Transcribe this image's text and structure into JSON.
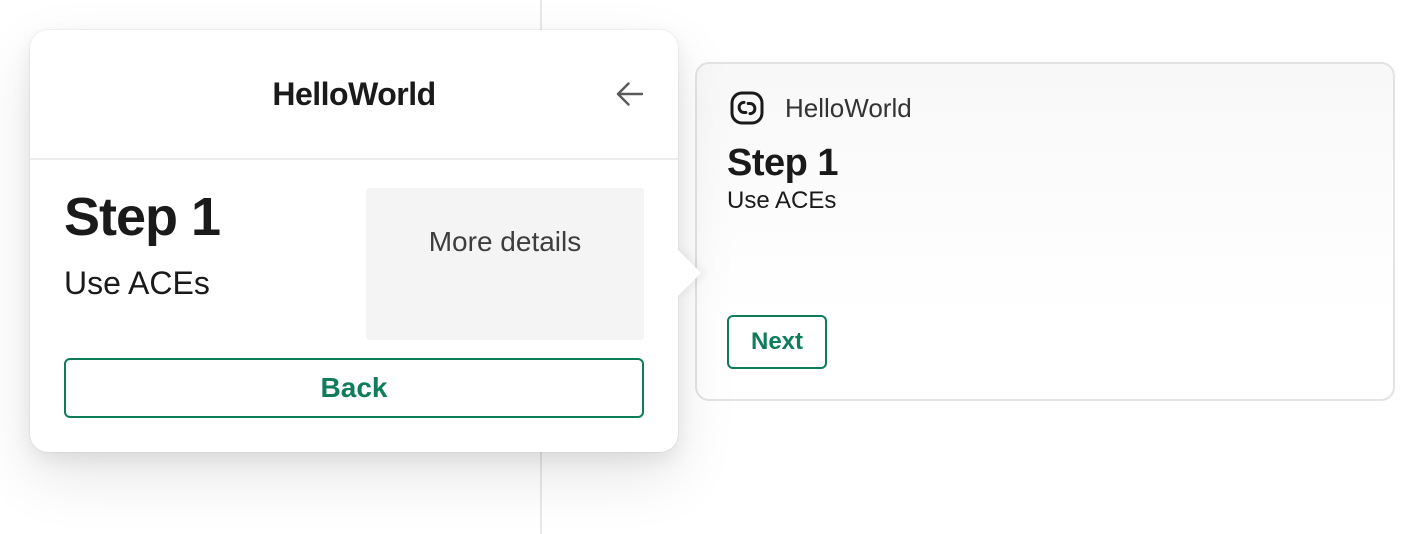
{
  "popover": {
    "title": "HelloWorld",
    "step_heading": "Step 1",
    "step_sub": "Use ACEs",
    "more_details_label": "More details",
    "back_label": "Back"
  },
  "card": {
    "title": "HelloWorld",
    "step_heading": "Step 1",
    "step_sub": "Use ACEs",
    "next_label": "Next"
  },
  "colors": {
    "accent": "#0f7c5a"
  },
  "icons": {
    "back_arrow": "arrow-left-icon",
    "link": "link-icon"
  }
}
